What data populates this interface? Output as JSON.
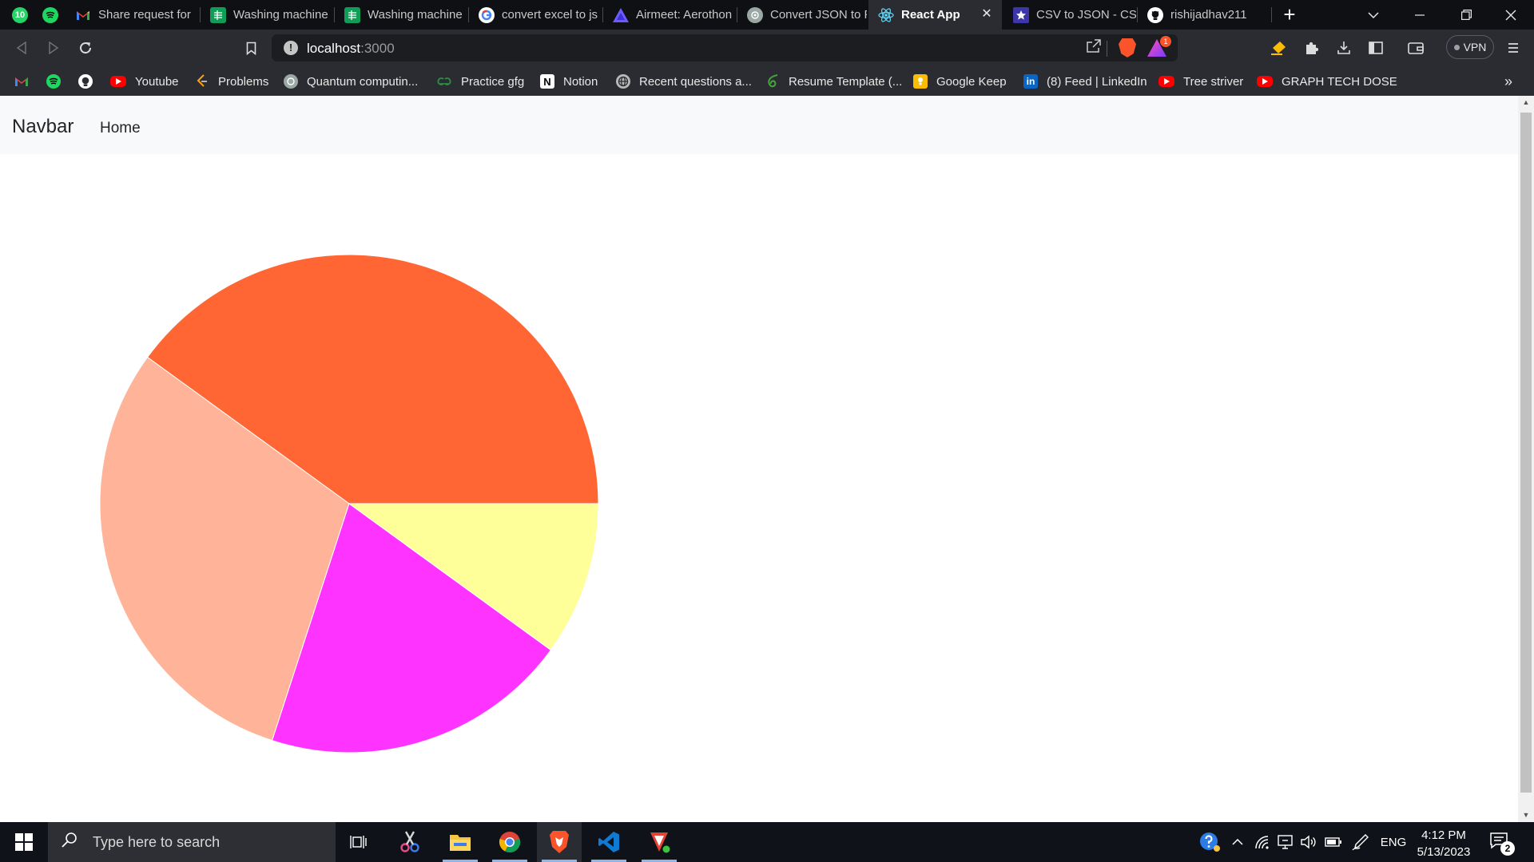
{
  "browser": {
    "pinned_tabs": [
      {
        "icon": "whatsapp-icon",
        "badge": "10",
        "color": "#25d366"
      },
      {
        "icon": "spotify-icon",
        "color": "#1ed760"
      }
    ],
    "tabs": [
      {
        "label": "Share request for",
        "icon": "gmail-icon",
        "active": false
      },
      {
        "label": "Washing machine",
        "icon": "google-sheets-icon",
        "active": false
      },
      {
        "label": "Washing machine",
        "icon": "google-sheets-icon",
        "active": false
      },
      {
        "label": "convert excel to js",
        "icon": "google-icon",
        "active": false
      },
      {
        "label": "Airmeet: Aerothon",
        "icon": "airmeet-icon",
        "active": false
      },
      {
        "label": "Convert JSON to F",
        "icon": "chatgpt-icon",
        "active": false
      },
      {
        "label": "React App",
        "icon": "react-icon",
        "active": true
      },
      {
        "label": "CSV to JSON - CSV",
        "icon": "csvjson-icon",
        "active": false
      },
      {
        "label": "rishijadhav211",
        "icon": "github-icon",
        "active": false
      }
    ],
    "address": {
      "host": "localhost",
      "port": ":3000"
    },
    "vpn_label": "VPN",
    "rewards_count": "1",
    "bookmarks": [
      {
        "label": "",
        "icon": "gmail-icon"
      },
      {
        "label": "",
        "icon": "spotify-icon"
      },
      {
        "label": "",
        "icon": "github-icon"
      },
      {
        "label": "Youtube",
        "icon": "youtube-icon"
      },
      {
        "label": "Problems",
        "icon": "leetcode-icon"
      },
      {
        "label": "Quantum computin...",
        "icon": "chatgpt-icon"
      },
      {
        "label": "Practice gfg",
        "icon": "gfg-icon"
      },
      {
        "label": "Notion",
        "icon": "notion-icon"
      },
      {
        "label": "Recent questions a...",
        "icon": "globe-icon"
      },
      {
        "label": "Resume Template (...",
        "icon": "overleaf-icon"
      },
      {
        "label": "Google Keep",
        "icon": "google-keep-icon"
      },
      {
        "label": "(8) Feed | LinkedIn",
        "icon": "linkedin-icon"
      },
      {
        "label": "Tree striver",
        "icon": "youtube-icon"
      },
      {
        "label": "GRAPH TECH DOSE",
        "icon": "youtube-icon"
      }
    ]
  },
  "page": {
    "brand": "Navbar",
    "nav_links": [
      "Home"
    ]
  },
  "chart_data": {
    "type": "pie",
    "title": "",
    "start_angle_deg": 0,
    "direction": "counterclockwise",
    "values": [
      40,
      30,
      20,
      10
    ],
    "colors": [
      "#ff6633",
      "#ffb399",
      "#ff33ff",
      "#ffff99"
    ]
  },
  "taskbar": {
    "search_placeholder": "Type here to search",
    "apps": [
      "task-view-icon",
      "snipping-tool-icon",
      "file-explorer-icon",
      "chrome-icon",
      "brave-icon",
      "vscode-icon",
      "vlc-icon"
    ],
    "language": "ENG",
    "time": "4:12 PM",
    "date": "5/13/2023",
    "notification_count": "2"
  }
}
